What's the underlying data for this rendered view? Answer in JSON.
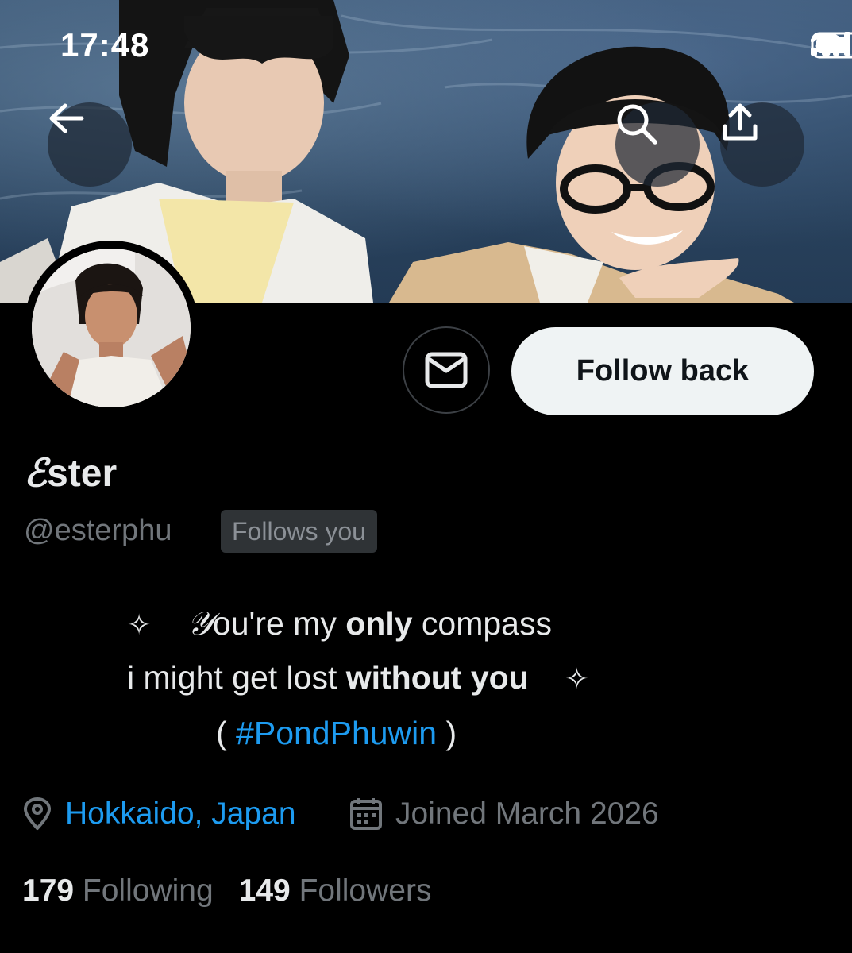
{
  "status_bar": {
    "time": "17:48"
  },
  "header": {
    "back_icon": "arrow-left-icon",
    "search_icon": "search-icon",
    "share_icon": "share-icon"
  },
  "actions": {
    "message_icon": "envelope-icon",
    "follow_label": "Follow back"
  },
  "profile": {
    "display_name_prefix": "ℰ",
    "display_name_rest": "ster",
    "handle": "@esterphu",
    "follows_you_badge": "Follows you"
  },
  "bio": {
    "line1_diamond": "✧",
    "line1_script": "𝒴",
    "line1_a": "ou're my ",
    "line1_bold": "only",
    "line1_b": " compass",
    "line2_a": "i might get lost ",
    "line2_bold": "without you",
    "line2_diamond": "✧",
    "line3_open": "( ",
    "line3_hashtag": "#PondPhuwin",
    "line3_close": " )"
  },
  "meta": {
    "location": "Hokkaido, Japan",
    "joined": "Joined March 2026",
    "location_icon": "location-pin-icon",
    "joined_icon": "calendar-icon"
  },
  "counts": {
    "following_count": "179",
    "following_label": "Following",
    "followers_count": "149",
    "followers_label": "Followers"
  },
  "colors": {
    "background": "#000000",
    "link_blue": "#1d9bf0",
    "muted_gray": "#71767b",
    "primary_text": "#e7e9ea",
    "follow_button_bg": "#eff3f4"
  }
}
